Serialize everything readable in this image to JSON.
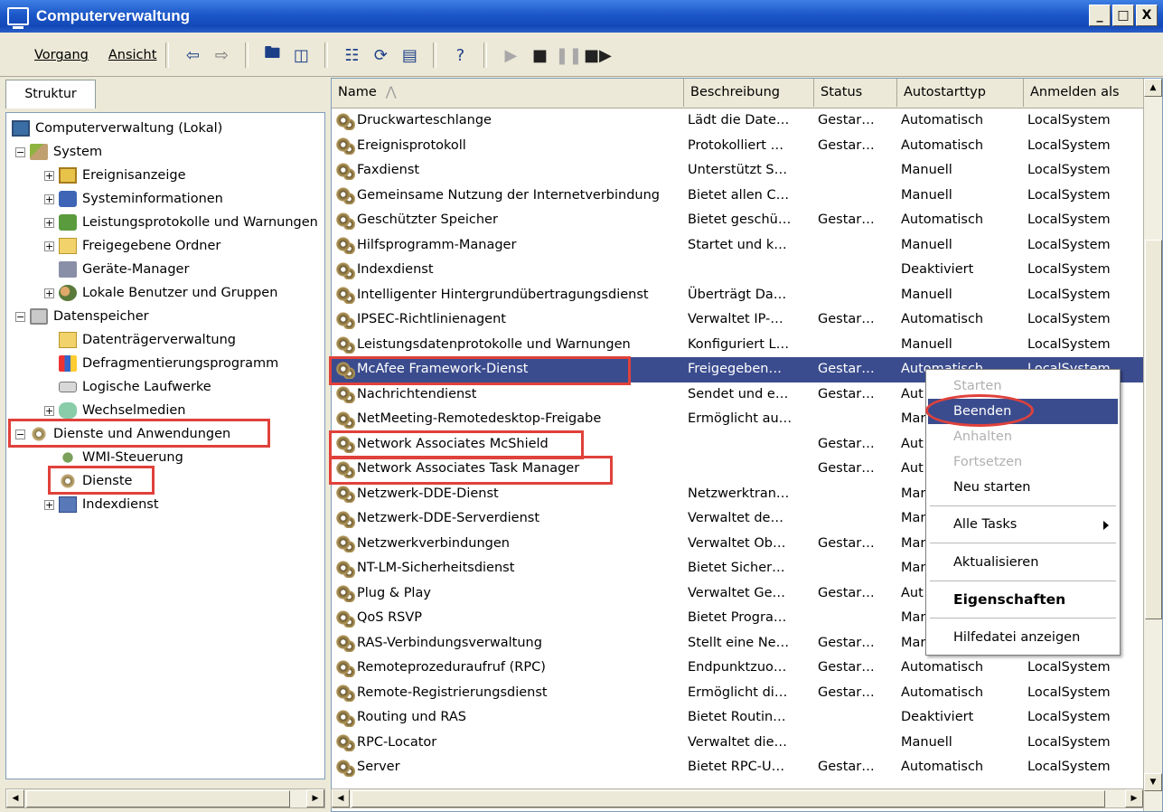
{
  "window": {
    "title": "Computerverwaltung",
    "buttons": [
      "_",
      "□",
      "X"
    ]
  },
  "menu": [
    "Vorgang",
    "Ansicht"
  ],
  "toolbar_icons": [
    "back-arrow-icon",
    "forward-arrow-icon",
    "up-folder-icon",
    "show-hide-tree-icon",
    "properties-icon",
    "refresh-icon",
    "export-list-icon",
    "help-icon",
    "play-icon",
    "stop-icon",
    "pause-icon",
    "restart-icon"
  ],
  "tree": {
    "tab": "Struktur",
    "nodes": [
      {
        "label": "Computerverwaltung (Lokal)",
        "icon": "computer-icon"
      },
      {
        "label": "System",
        "icon": "tools-icon"
      },
      {
        "label": "Ereignisanzeige",
        "icon": "event-viewer-icon"
      },
      {
        "label": "Systeminformationen",
        "icon": "system-info-icon"
      },
      {
        "label": "Leistungsprotokolle und Warnungen",
        "icon": "performance-icon"
      },
      {
        "label": "Freigegebene Ordner",
        "icon": "shared-folder-icon"
      },
      {
        "label": "Geräte-Manager",
        "icon": "device-manager-icon"
      },
      {
        "label": "Lokale Benutzer und Gruppen",
        "icon": "users-icon"
      },
      {
        "label": "Datenspeicher",
        "icon": "storage-icon"
      },
      {
        "label": "Datenträgerverwaltung",
        "icon": "disk-icon"
      },
      {
        "label": "Defragmentierungsprogramm",
        "icon": "defrag-icon"
      },
      {
        "label": "Logische Laufwerke",
        "icon": "drive-icon"
      },
      {
        "label": "Wechselmedien",
        "icon": "removable-media-icon"
      },
      {
        "label": "Dienste und Anwendungen",
        "icon": "services-apps-icon"
      },
      {
        "label": "WMI-Steuerung",
        "icon": "wmi-icon"
      },
      {
        "label": "Dienste",
        "icon": "services-icon"
      },
      {
        "label": "Indexdienst",
        "icon": "index-icon"
      }
    ]
  },
  "list": {
    "columns": [
      "Name",
      "Beschreibung",
      "Status",
      "Autostarttyp",
      "Anmelden als"
    ],
    "rows": [
      [
        "Druckwarteschlange",
        "Lädt die Date…",
        "Gestar…",
        "Automatisch",
        "LocalSystem"
      ],
      [
        "Ereignisprotokoll",
        "Protokolliert …",
        "Gestar…",
        "Automatisch",
        "LocalSystem"
      ],
      [
        "Faxdienst",
        "Unterstützt S…",
        "",
        "Manuell",
        "LocalSystem"
      ],
      [
        "Gemeinsame Nutzung der Internetverbindung",
        "Bietet allen C…",
        "",
        "Manuell",
        "LocalSystem"
      ],
      [
        "Geschützter Speicher",
        "Bietet geschü…",
        "Gestar…",
        "Automatisch",
        "LocalSystem"
      ],
      [
        "Hilfsprogramm-Manager",
        "Startet und k…",
        "",
        "Manuell",
        "LocalSystem"
      ],
      [
        "Indexdienst",
        "",
        "",
        "Deaktiviert",
        "LocalSystem"
      ],
      [
        "Intelligenter Hintergrundübertragungsdienst",
        "Überträgt Da…",
        "",
        "Manuell",
        "LocalSystem"
      ],
      [
        "IPSEC-Richtlinienagent",
        "Verwaltet IP-…",
        "Gestar…",
        "Automatisch",
        "LocalSystem"
      ],
      [
        "Leistungsdatenprotokolle und Warnungen",
        "Konfiguriert L…",
        "",
        "Manuell",
        "LocalSystem"
      ],
      [
        "McAfee Framework-Dienst",
        "Freigegeben…",
        "Gestar…",
        "Automatisch",
        "LocalSystem"
      ],
      [
        "Nachrichtendienst",
        "Sendet und e…",
        "Gestar…",
        "Aut",
        ""
      ],
      [
        "NetMeeting-Remotedesktop-Freigabe",
        "Ermöglicht au…",
        "",
        "Mar",
        ""
      ],
      [
        "Network Associates McShield",
        "",
        "Gestar…",
        "Aut",
        ""
      ],
      [
        "Network Associates Task Manager",
        "",
        "Gestar…",
        "Aut",
        ""
      ],
      [
        "Netzwerk-DDE-Dienst",
        "Netzwerktran…",
        "",
        "Mar",
        ""
      ],
      [
        "Netzwerk-DDE-Serverdienst",
        "Verwaltet de…",
        "",
        "Mar",
        ""
      ],
      [
        "Netzwerkverbindungen",
        "Verwaltet Ob…",
        "Gestar…",
        "Mar",
        ""
      ],
      [
        "NT-LM-Sicherheitsdienst",
        "Bietet Sicher…",
        "",
        "Mar",
        ""
      ],
      [
        "Plug & Play",
        "Verwaltet Ge…",
        "Gestar…",
        "Aut",
        ""
      ],
      [
        "QoS RSVP",
        "Bietet Progra…",
        "",
        "Mar",
        ""
      ],
      [
        "RAS-Verbindungsverwaltung",
        "Stellt eine Ne…",
        "Gestar…",
        "Mar",
        ""
      ],
      [
        "Remoteprozeduraufruf (RPC)",
        "Endpunktzuo…",
        "Gestar…",
        "Automatisch",
        "LocalSystem"
      ],
      [
        "Remote-Registrierungsdienst",
        "Ermöglicht di…",
        "Gestar…",
        "Automatisch",
        "LocalSystem"
      ],
      [
        "Routing und RAS",
        "Bietet Routin…",
        "",
        "Deaktiviert",
        "LocalSystem"
      ],
      [
        "RPC-Locator",
        "Verwaltet die…",
        "",
        "Manuell",
        "LocalSystem"
      ],
      [
        "Server",
        "Bietet RPC-U…",
        "Gestar…",
        "Automatisch",
        "LocalSystem"
      ]
    ],
    "selected_index": 10
  },
  "context_menu": {
    "items": [
      {
        "label": "Starten",
        "state": "disabled"
      },
      {
        "label": "Beenden",
        "state": "highlighted"
      },
      {
        "label": "Anhalten",
        "state": "disabled"
      },
      {
        "label": "Fortsetzen",
        "state": "disabled"
      },
      {
        "label": "Neu starten",
        "state": "enabled"
      },
      {
        "label": "Alle Tasks",
        "state": "submenu"
      },
      {
        "label": "Aktualisieren",
        "state": "enabled"
      },
      {
        "label": "Eigenschaften",
        "state": "bold"
      },
      {
        "label": "Hilfedatei anzeigen",
        "state": "enabled"
      }
    ]
  },
  "colors": {
    "selection": "#3b4c8e",
    "annotation": "#e0413b",
    "titlebar": "#1d57c8"
  }
}
